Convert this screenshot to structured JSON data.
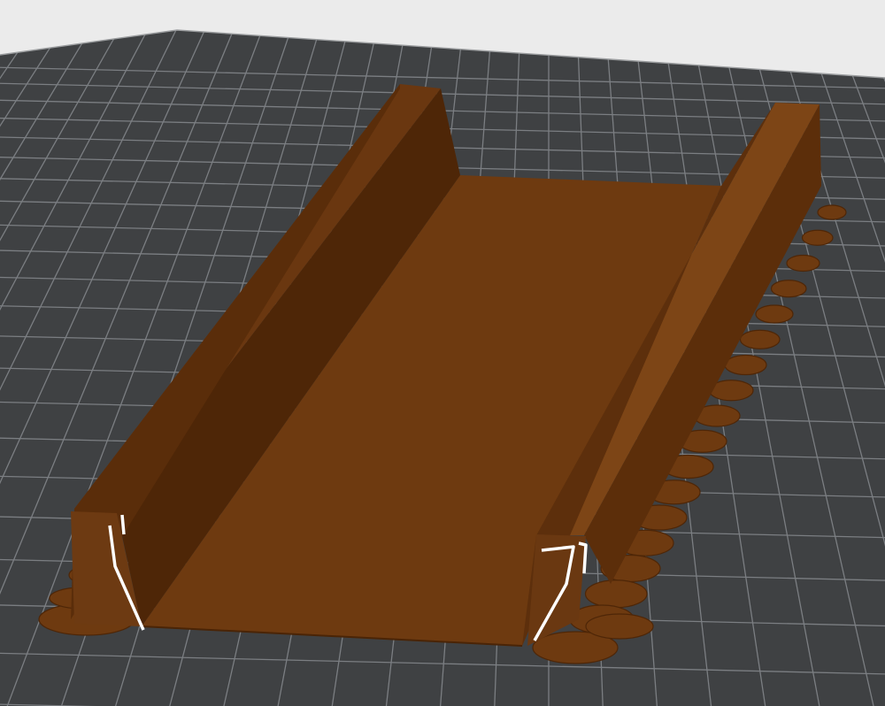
{
  "viewport": {
    "background_color": "#ebebeb",
    "plate_color": "#3f4143",
    "grid_color": "#7b7e82",
    "model_color": "#6e3a10",
    "model_dark_color": "#4e2607",
    "model_light_color": "#7d4516",
    "seam_color": "#ffffff"
  }
}
